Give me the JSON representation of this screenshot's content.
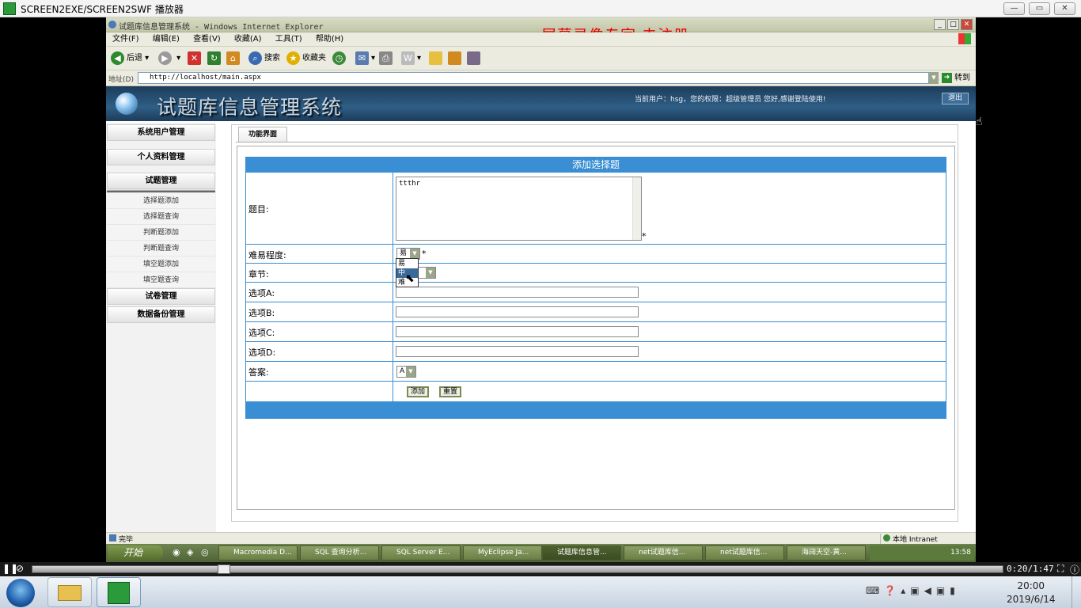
{
  "player": {
    "title": "SCREEN2EXE/SCREEN2SWF 播放器",
    "time": "0:20/1:47"
  },
  "ie": {
    "title": "试题库信息管理系统 - Windows Internet Explorer",
    "watermark": "屏幕录像专家  未注册",
    "menu": [
      "文件(F)",
      "编辑(E)",
      "查看(V)",
      "收藏(A)",
      "工具(T)",
      "帮助(H)"
    ],
    "toolbar": {
      "back": "后退",
      "search": "搜索",
      "favorites": "收藏夹"
    },
    "address_label": "地址(D)",
    "address": "http://localhost/main.aspx",
    "go": "转到",
    "status": "完毕",
    "zone": "本地 Intranet"
  },
  "site": {
    "title": "试题库信息管理系统",
    "user_info": "当前用户：hsg，您的权限：超级管理员 您好,感谢登陆使用!",
    "logout": "退出"
  },
  "sidebar": {
    "system_users": "系统用户管理",
    "profile": "个人资料管理",
    "question_mgmt": "试题管理",
    "sub_items": [
      "选择题添加",
      "选择题查询",
      "判断题添加",
      "判断题查询",
      "填空题添加",
      "填空题查询"
    ],
    "exam_mgmt": "试卷管理",
    "backup": "数据备份管理"
  },
  "content": {
    "tab": "功能界面",
    "form_title": "添加选择题",
    "labels": {
      "question": "题目:",
      "difficulty": "难易程度:",
      "chapter": "章节:",
      "option_a": "选项A:",
      "option_b": "选项B:",
      "option_c": "选项C:",
      "option_d": "选项D:",
      "answer": "答案:"
    },
    "question_value": "ttthr",
    "required_mark": "*",
    "difficulty_selected": "易",
    "difficulty_options": [
      "易",
      "中",
      "难"
    ],
    "answer_selected": "A",
    "add_button": "添加",
    "reset_button": "重置"
  },
  "taskbar": {
    "start": "开始",
    "items": [
      "Macromedia D...",
      "SQL 查询分析...",
      "SQL Server E...",
      "MyEclipse Ja...",
      "试题库信息管...",
      "net试题库信...",
      "net试题库信...",
      "海阔天空-黄..."
    ],
    "tray_time": "13:58"
  },
  "win7": {
    "time": "20:00",
    "date": "2019/6/14"
  }
}
